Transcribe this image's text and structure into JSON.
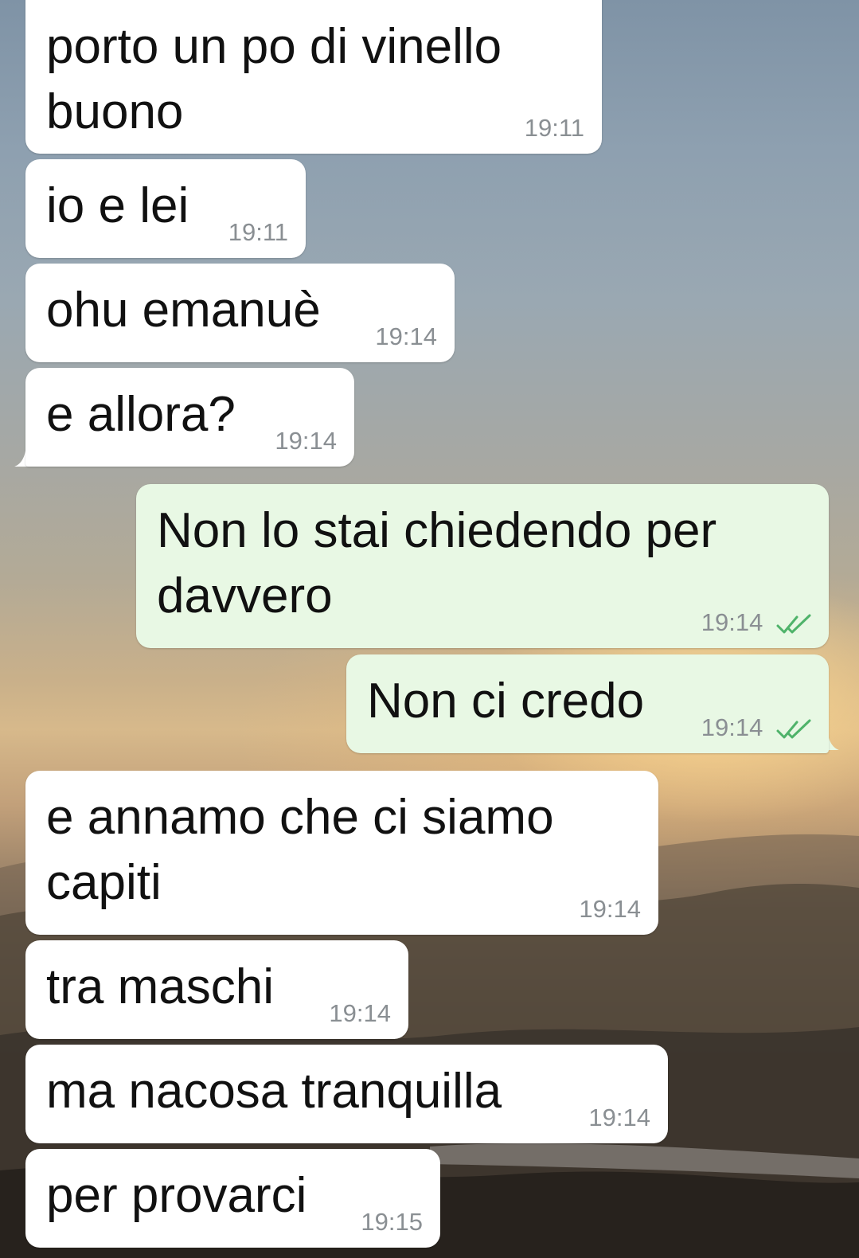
{
  "messages": [
    {
      "direction": "incoming",
      "text": "porto un po di vinello\nbuono",
      "time": "19:11"
    },
    {
      "direction": "incoming",
      "text": "io e lei",
      "time": "19:11"
    },
    {
      "direction": "incoming",
      "text": "ohu emanuè",
      "time": "19:14"
    },
    {
      "direction": "incoming",
      "text": "e allora?",
      "time": "19:14"
    },
    {
      "direction": "outgoing",
      "text": "Non lo stai chiedendo per\ndavvero",
      "time": "19:14",
      "status": "read",
      "status_icon": "double-check-icon"
    },
    {
      "direction": "outgoing",
      "text": "Non ci credo",
      "time": "19:14",
      "status": "read",
      "status_icon": "double-check-icon"
    },
    {
      "direction": "incoming",
      "text": "e annamo che ci siamo\ncapiti",
      "time": "19:14"
    },
    {
      "direction": "incoming",
      "text": "tra maschi",
      "time": "19:14"
    },
    {
      "direction": "incoming",
      "text": "ma nacosa tranquilla",
      "time": "19:14"
    },
    {
      "direction": "incoming",
      "text": "per provarci",
      "time": "19:15"
    }
  ],
  "colors": {
    "incoming_bubble": "#ffffff",
    "outgoing_bubble": "#e8f8e4",
    "timestamp": "#8a8f93",
    "read_ticks": "#4fb36a"
  }
}
